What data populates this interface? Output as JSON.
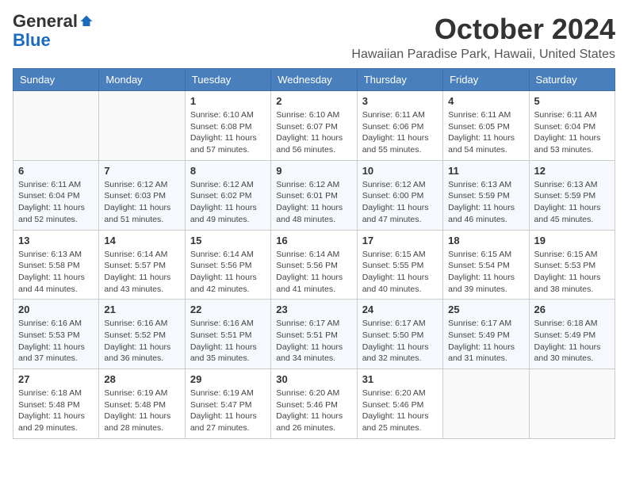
{
  "header": {
    "logo": {
      "general": "General",
      "blue": "Blue",
      "tagline": ""
    },
    "title": "October 2024",
    "location": "Hawaiian Paradise Park, Hawaii, United States"
  },
  "days_of_week": [
    "Sunday",
    "Monday",
    "Tuesday",
    "Wednesday",
    "Thursday",
    "Friday",
    "Saturday"
  ],
  "weeks": [
    [
      {
        "day": "",
        "sunrise": "",
        "sunset": "",
        "daylight": ""
      },
      {
        "day": "",
        "sunrise": "",
        "sunset": "",
        "daylight": ""
      },
      {
        "day": "1",
        "sunrise": "Sunrise: 6:10 AM",
        "sunset": "Sunset: 6:08 PM",
        "daylight": "Daylight: 11 hours and 57 minutes."
      },
      {
        "day": "2",
        "sunrise": "Sunrise: 6:10 AM",
        "sunset": "Sunset: 6:07 PM",
        "daylight": "Daylight: 11 hours and 56 minutes."
      },
      {
        "day": "3",
        "sunrise": "Sunrise: 6:11 AM",
        "sunset": "Sunset: 6:06 PM",
        "daylight": "Daylight: 11 hours and 55 minutes."
      },
      {
        "day": "4",
        "sunrise": "Sunrise: 6:11 AM",
        "sunset": "Sunset: 6:05 PM",
        "daylight": "Daylight: 11 hours and 54 minutes."
      },
      {
        "day": "5",
        "sunrise": "Sunrise: 6:11 AM",
        "sunset": "Sunset: 6:04 PM",
        "daylight": "Daylight: 11 hours and 53 minutes."
      }
    ],
    [
      {
        "day": "6",
        "sunrise": "Sunrise: 6:11 AM",
        "sunset": "Sunset: 6:04 PM",
        "daylight": "Daylight: 11 hours and 52 minutes."
      },
      {
        "day": "7",
        "sunrise": "Sunrise: 6:12 AM",
        "sunset": "Sunset: 6:03 PM",
        "daylight": "Daylight: 11 hours and 51 minutes."
      },
      {
        "day": "8",
        "sunrise": "Sunrise: 6:12 AM",
        "sunset": "Sunset: 6:02 PM",
        "daylight": "Daylight: 11 hours and 49 minutes."
      },
      {
        "day": "9",
        "sunrise": "Sunrise: 6:12 AM",
        "sunset": "Sunset: 6:01 PM",
        "daylight": "Daylight: 11 hours and 48 minutes."
      },
      {
        "day": "10",
        "sunrise": "Sunrise: 6:12 AM",
        "sunset": "Sunset: 6:00 PM",
        "daylight": "Daylight: 11 hours and 47 minutes."
      },
      {
        "day": "11",
        "sunrise": "Sunrise: 6:13 AM",
        "sunset": "Sunset: 5:59 PM",
        "daylight": "Daylight: 11 hours and 46 minutes."
      },
      {
        "day": "12",
        "sunrise": "Sunrise: 6:13 AM",
        "sunset": "Sunset: 5:59 PM",
        "daylight": "Daylight: 11 hours and 45 minutes."
      }
    ],
    [
      {
        "day": "13",
        "sunrise": "Sunrise: 6:13 AM",
        "sunset": "Sunset: 5:58 PM",
        "daylight": "Daylight: 11 hours and 44 minutes."
      },
      {
        "day": "14",
        "sunrise": "Sunrise: 6:14 AM",
        "sunset": "Sunset: 5:57 PM",
        "daylight": "Daylight: 11 hours and 43 minutes."
      },
      {
        "day": "15",
        "sunrise": "Sunrise: 6:14 AM",
        "sunset": "Sunset: 5:56 PM",
        "daylight": "Daylight: 11 hours and 42 minutes."
      },
      {
        "day": "16",
        "sunrise": "Sunrise: 6:14 AM",
        "sunset": "Sunset: 5:56 PM",
        "daylight": "Daylight: 11 hours and 41 minutes."
      },
      {
        "day": "17",
        "sunrise": "Sunrise: 6:15 AM",
        "sunset": "Sunset: 5:55 PM",
        "daylight": "Daylight: 11 hours and 40 minutes."
      },
      {
        "day": "18",
        "sunrise": "Sunrise: 6:15 AM",
        "sunset": "Sunset: 5:54 PM",
        "daylight": "Daylight: 11 hours and 39 minutes."
      },
      {
        "day": "19",
        "sunrise": "Sunrise: 6:15 AM",
        "sunset": "Sunset: 5:53 PM",
        "daylight": "Daylight: 11 hours and 38 minutes."
      }
    ],
    [
      {
        "day": "20",
        "sunrise": "Sunrise: 6:16 AM",
        "sunset": "Sunset: 5:53 PM",
        "daylight": "Daylight: 11 hours and 37 minutes."
      },
      {
        "day": "21",
        "sunrise": "Sunrise: 6:16 AM",
        "sunset": "Sunset: 5:52 PM",
        "daylight": "Daylight: 11 hours and 36 minutes."
      },
      {
        "day": "22",
        "sunrise": "Sunrise: 6:16 AM",
        "sunset": "Sunset: 5:51 PM",
        "daylight": "Daylight: 11 hours and 35 minutes."
      },
      {
        "day": "23",
        "sunrise": "Sunrise: 6:17 AM",
        "sunset": "Sunset: 5:51 PM",
        "daylight": "Daylight: 11 hours and 34 minutes."
      },
      {
        "day": "24",
        "sunrise": "Sunrise: 6:17 AM",
        "sunset": "Sunset: 5:50 PM",
        "daylight": "Daylight: 11 hours and 32 minutes."
      },
      {
        "day": "25",
        "sunrise": "Sunrise: 6:17 AM",
        "sunset": "Sunset: 5:49 PM",
        "daylight": "Daylight: 11 hours and 31 minutes."
      },
      {
        "day": "26",
        "sunrise": "Sunrise: 6:18 AM",
        "sunset": "Sunset: 5:49 PM",
        "daylight": "Daylight: 11 hours and 30 minutes."
      }
    ],
    [
      {
        "day": "27",
        "sunrise": "Sunrise: 6:18 AM",
        "sunset": "Sunset: 5:48 PM",
        "daylight": "Daylight: 11 hours and 29 minutes."
      },
      {
        "day": "28",
        "sunrise": "Sunrise: 6:19 AM",
        "sunset": "Sunset: 5:48 PM",
        "daylight": "Daylight: 11 hours and 28 minutes."
      },
      {
        "day": "29",
        "sunrise": "Sunrise: 6:19 AM",
        "sunset": "Sunset: 5:47 PM",
        "daylight": "Daylight: 11 hours and 27 minutes."
      },
      {
        "day": "30",
        "sunrise": "Sunrise: 6:20 AM",
        "sunset": "Sunset: 5:46 PM",
        "daylight": "Daylight: 11 hours and 26 minutes."
      },
      {
        "day": "31",
        "sunrise": "Sunrise: 6:20 AM",
        "sunset": "Sunset: 5:46 PM",
        "daylight": "Daylight: 11 hours and 25 minutes."
      },
      {
        "day": "",
        "sunrise": "",
        "sunset": "",
        "daylight": ""
      },
      {
        "day": "",
        "sunrise": "",
        "sunset": "",
        "daylight": ""
      }
    ]
  ]
}
